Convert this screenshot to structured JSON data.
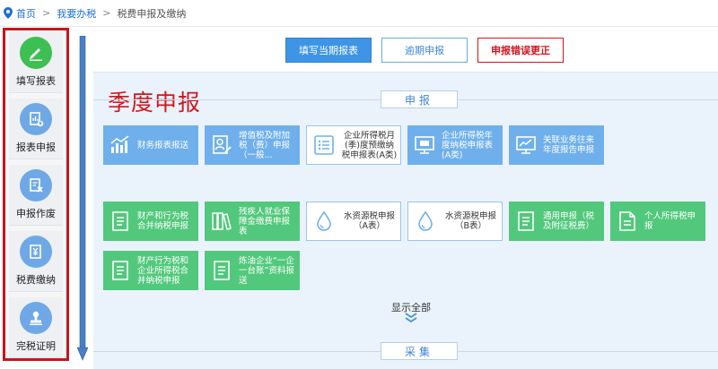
{
  "breadcrumb": {
    "home": "首页",
    "my_tax": "我要办税",
    "current": "税费申报及缴纳",
    "separator": ">"
  },
  "sidebar": {
    "items": [
      {
        "label": "填写报表",
        "icon": "pencil-icon"
      },
      {
        "label": "报表申报",
        "icon": "report-upload-icon"
      },
      {
        "label": "申报作废",
        "icon": "document-void-icon"
      },
      {
        "label": "税费缴纳",
        "icon": "tax-payment-icon"
      },
      {
        "label": "完税证明",
        "icon": "stamp-icon"
      }
    ]
  },
  "toolbar": {
    "fill_current": "填写当期报表",
    "overdue": "逾期申报",
    "correction": "申报错误更正"
  },
  "main": {
    "quarter_title": "季度申报",
    "section_declare": "申报",
    "section_collect": "采集",
    "show_all": "显示全部"
  },
  "cards": [
    {
      "text": "财务报表报送",
      "style": "blue",
      "icon": "bar-chart-icon"
    },
    {
      "text": "增值税及附加税（费）申报（一般...",
      "style": "blue",
      "icon": "person-form-icon"
    },
    {
      "text": "企业所得税月(季)度预缴纳税申报表(A类)",
      "style": "white",
      "icon": "list-icon"
    },
    {
      "text": "企业所得税年度纳税申报表(A类)",
      "style": "blue",
      "icon": "monitor-icon"
    },
    {
      "text": "关联业务往来年度报告申报",
      "style": "blue",
      "icon": "line-chart-icon"
    },
    {
      "text": "财产和行为税合并纳税申报",
      "style": "green",
      "icon": "document-icon"
    },
    {
      "text": "残疾人就业保障金缴费申报表",
      "style": "green",
      "icon": "books-icon"
    },
    {
      "text": "水资源税申报（A表）",
      "style": "white",
      "icon": "water-drop-icon"
    },
    {
      "text": "水资源税申报（B表）",
      "style": "white",
      "icon": "water-drop-icon"
    },
    {
      "text": "通用申报（税及附征税费）",
      "style": "green",
      "icon": "document-icon"
    },
    {
      "text": "个人所得税申报",
      "style": "green",
      "icon": "file-icon"
    },
    {
      "text": "财产行为税和企业所得税合并纳税申报",
      "style": "green",
      "icon": "document-icon"
    },
    {
      "text": "炼油企业“一企一台账”资料报送",
      "style": "green",
      "icon": "document-icon"
    }
  ],
  "colors": {
    "accent_blue": "#3e95e6",
    "card_blue": "#6fb0ec",
    "card_green": "#52c87c",
    "alert_red": "#d4141d"
  }
}
